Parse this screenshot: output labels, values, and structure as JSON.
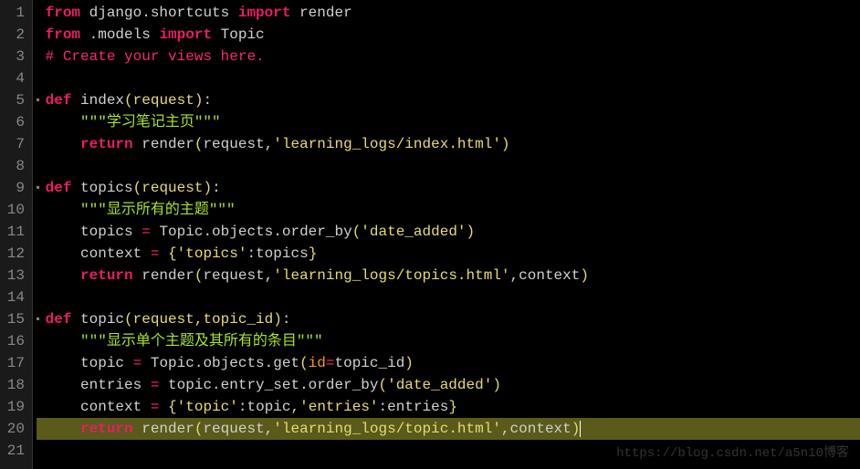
{
  "gutter": {
    "lines": [
      "1",
      "2",
      "3",
      "4",
      "5",
      "6",
      "7",
      "8",
      "9",
      "10",
      "11",
      "12",
      "13",
      "14",
      "15",
      "16",
      "17",
      "18",
      "19",
      "20",
      "21"
    ]
  },
  "code": {
    "l1": {
      "from": "from",
      "mod": " django.shortcuts ",
      "import": "import",
      "name": " render"
    },
    "l2": {
      "from": "from",
      "mod": " .models ",
      "import": "import",
      "name": " Topic"
    },
    "l3": {
      "comment": "# Create your views here."
    },
    "l5": {
      "def": "def",
      "name": " index",
      "params": "(request)",
      "colon": ":"
    },
    "l6": {
      "docstring": "\"\"\"学习笔记主页\"\"\""
    },
    "l7": {
      "return": "return",
      "fn": " render",
      "open": "(",
      "p1": "request",
      "c1": ",",
      "s1": "'learning_logs/index.html'",
      "close": ")"
    },
    "l9": {
      "def": "def",
      "name": " topics",
      "params": "(request)",
      "colon": ":"
    },
    "l10": {
      "docstring": "\"\"\"显示所有的主题\"\"\""
    },
    "l11": {
      "var": "topics ",
      "eq": "=",
      "rest": " Topic.objects.order_by",
      "open": "(",
      "s1": "'date_added'",
      "close": ")"
    },
    "l12": {
      "var": "context ",
      "eq": "=",
      "sp": " ",
      "ob": "{",
      "s1": "'topics'",
      "colon": ":",
      "v1": "topics",
      "cb": "}"
    },
    "l13": {
      "return": "return",
      "fn": " render",
      "open": "(",
      "p1": "request",
      "c1": ",",
      "s1": "'learning_logs/topics.html'",
      "c2": ",",
      "p2": "context",
      "close": ")"
    },
    "l15": {
      "def": "def",
      "name": " topic",
      "params": "(request,topic_id)",
      "colon": ":"
    },
    "l16": {
      "docstring": "\"\"\"显示单个主题及其所有的条目\"\"\""
    },
    "l17": {
      "var": "topic ",
      "eq": "=",
      "rest": " Topic.objects.get",
      "open": "(",
      "kw": "id",
      "eq2": "=",
      "v": "topic_id",
      "close": ")"
    },
    "l18": {
      "var": "entries ",
      "eq": "=",
      "rest": " topic.entry_set.order_by",
      "open": "(",
      "s1": "'date_added'",
      "close": ")"
    },
    "l19": {
      "var": "context ",
      "eq": "=",
      "sp": " ",
      "ob": "{",
      "s1": "'topic'",
      "colon1": ":",
      "v1": "topic",
      "c1": ",",
      "s2": "'entries'",
      "colon2": ":",
      "v2": "entries",
      "cb": "}"
    },
    "l20": {
      "return": "return",
      "fn": " render",
      "open": "(",
      "p1": "request",
      "c1": ",",
      "s1": "'learning_logs/topic.html'",
      "c2": ",",
      "p2": "context",
      "close": ")"
    }
  },
  "fold_marker": "▪",
  "watermark": "https://blog.csdn.net/a5n10博客"
}
